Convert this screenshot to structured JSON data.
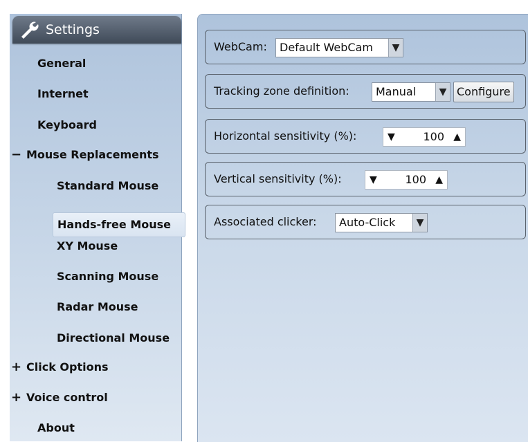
{
  "sidebar": {
    "title": "Settings",
    "items": {
      "general": "General",
      "internet": "Internet",
      "keyboard": "Keyboard",
      "mouse_replacements": {
        "sign": "−",
        "label": "Mouse Replacements"
      },
      "standard_mouse": "Standard Mouse",
      "hands_free_mouse": "Hands-free Mouse",
      "xy_mouse": "XY Mouse",
      "scanning_mouse": "Scanning Mouse",
      "radar_mouse": "Radar Mouse",
      "directional_mouse": "Directional Mouse",
      "click_options": {
        "sign": "+",
        "label": "Click Options"
      },
      "voice_control": {
        "sign": "+",
        "label": "Voice control"
      },
      "about": "About"
    }
  },
  "panels": {
    "webcam": {
      "label": "WebCam:",
      "value": "Default WebCam"
    },
    "tracking": {
      "label": "Tracking zone definition:",
      "value": "Manual",
      "button": "Configure"
    },
    "horizontal": {
      "label": "Horizontal sensitivity (%):",
      "value": "100"
    },
    "vertical": {
      "label": "Vertical sensitivity (%):",
      "value": "100"
    },
    "clicker": {
      "label": "Associated clicker:",
      "value": "Auto-Click"
    }
  },
  "glyphs": {
    "down": "▼",
    "up": "▲"
  },
  "colors": {
    "sidebar_top": "#aec3dc",
    "title_bar": "#3f4a58",
    "active_item": "#e4ecf6"
  }
}
